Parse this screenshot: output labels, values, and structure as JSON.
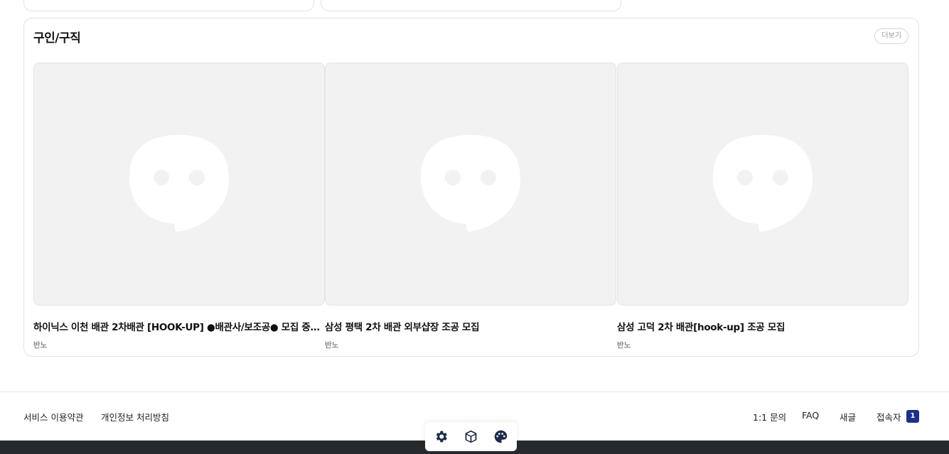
{
  "section": {
    "title": "구인/구직",
    "more_label": "더보기"
  },
  "posts": [
    {
      "title": "하이닉스 이천 배관 2차배관 [HOOK-UP] ●배관사/보조공● 모집 중 ...",
      "author": "반노",
      "thumbnail_icon": "chat-bubble-placeholder-icon"
    },
    {
      "title": "삼성 평택 2차 배관 외부샵장 조공 모집",
      "author": "반노",
      "thumbnail_icon": "chat-bubble-placeholder-icon"
    },
    {
      "title": "삼성 고덕 2차 배관[hook-up] 조공 모집",
      "author": "반노",
      "thumbnail_icon": "chat-bubble-placeholder-icon"
    }
  ],
  "footer": {
    "terms": "서비스 이용약관",
    "privacy": "개인정보 처리방침",
    "inquiry": "1:1 문의",
    "faq": "FAQ",
    "new_post": "새글",
    "visitors_label": "접속자",
    "visitors_count": "1"
  },
  "toolbar": {
    "icons": [
      "gear-icon",
      "cube-icon",
      "palette-icon"
    ]
  },
  "colors": {
    "accent": "#1f2f8f",
    "thumb_bg": "#f2f2f2",
    "bottom_bar": "#26292e"
  }
}
